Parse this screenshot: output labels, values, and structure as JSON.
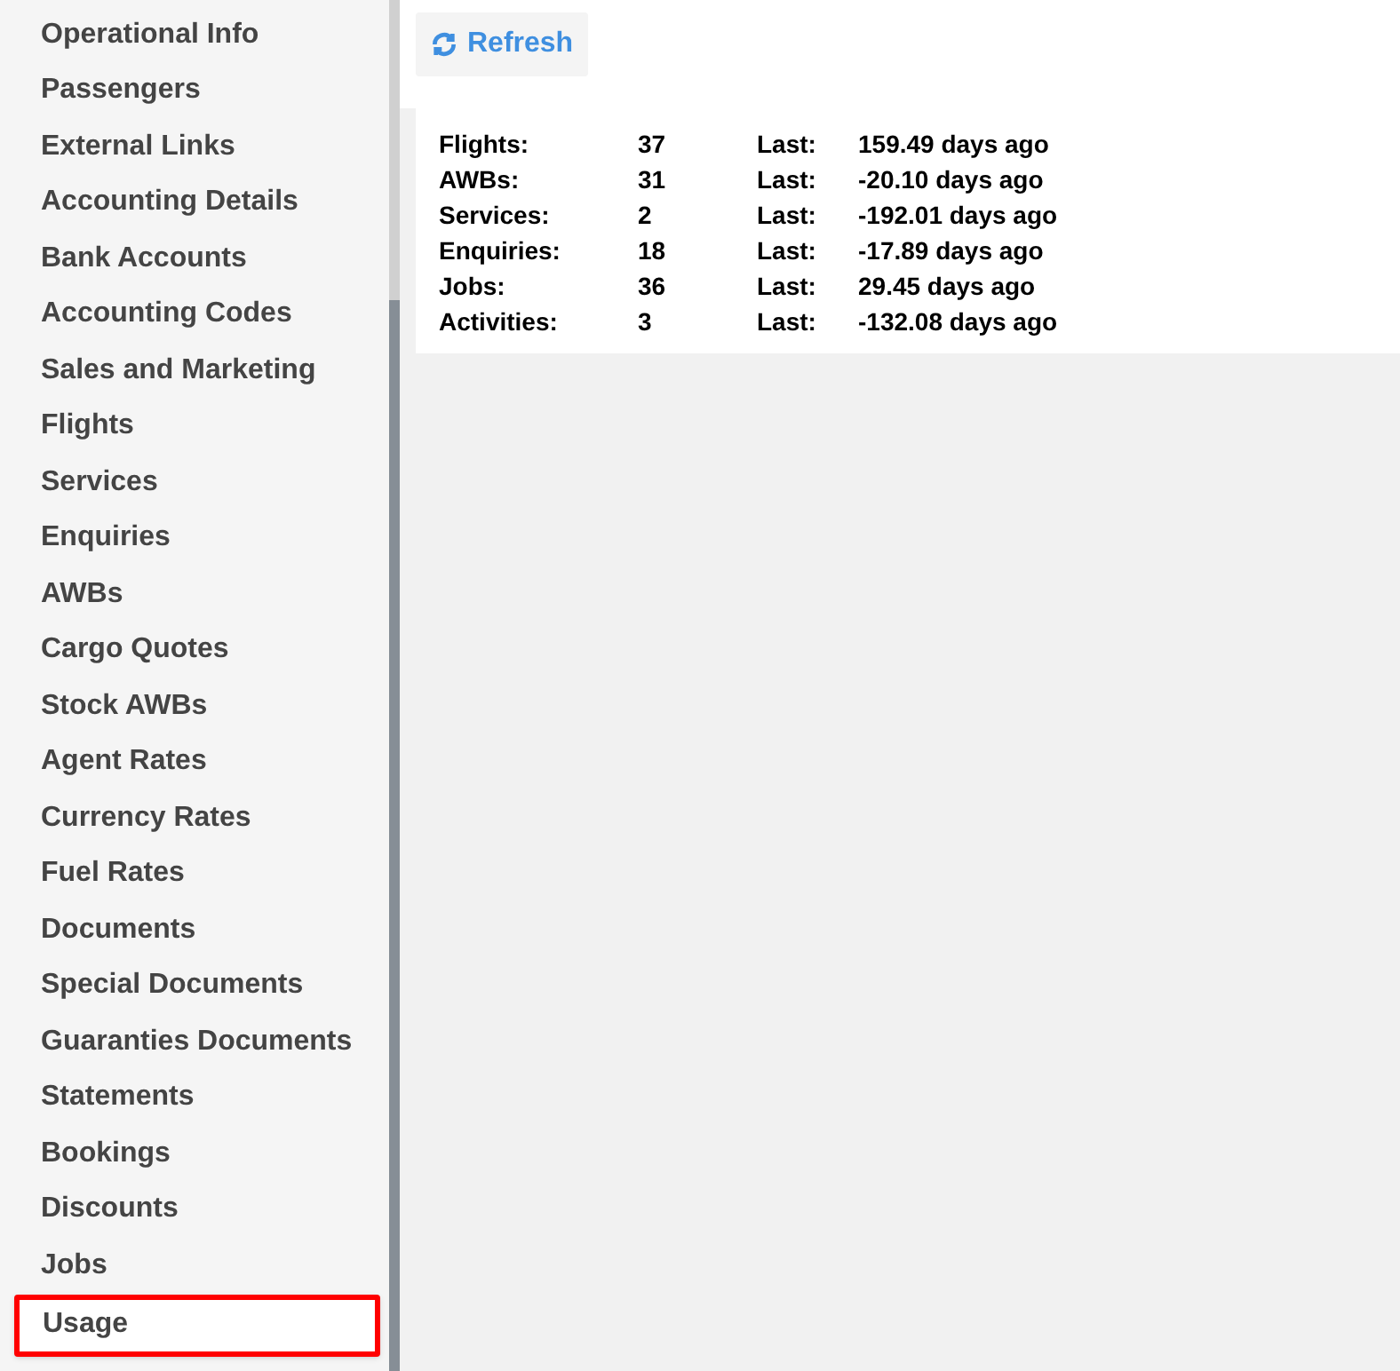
{
  "sidebar": {
    "items": [
      {
        "label": "Operational Info",
        "selected": false
      },
      {
        "label": "Passengers",
        "selected": false
      },
      {
        "label": "External Links",
        "selected": false
      },
      {
        "label": "Accounting Details",
        "selected": false
      },
      {
        "label": "Bank Accounts",
        "selected": false
      },
      {
        "label": "Accounting Codes",
        "selected": false
      },
      {
        "label": "Sales and Marketing",
        "selected": false
      },
      {
        "label": "Flights",
        "selected": false
      },
      {
        "label": "Services",
        "selected": false
      },
      {
        "label": "Enquiries",
        "selected": false
      },
      {
        "label": "AWBs",
        "selected": false
      },
      {
        "label": "Cargo Quotes",
        "selected": false
      },
      {
        "label": "Stock AWBs",
        "selected": false
      },
      {
        "label": "Agent Rates",
        "selected": false
      },
      {
        "label": "Currency Rates",
        "selected": false
      },
      {
        "label": "Fuel Rates",
        "selected": false
      },
      {
        "label": "Documents",
        "selected": false
      },
      {
        "label": "Special Documents",
        "selected": false
      },
      {
        "label": "Guaranties Documents",
        "selected": false
      },
      {
        "label": "Statements",
        "selected": false
      },
      {
        "label": "Bookings",
        "selected": false
      },
      {
        "label": "Discounts",
        "selected": false
      },
      {
        "label": "Jobs",
        "selected": false
      },
      {
        "label": "Usage",
        "selected": true
      }
    ]
  },
  "refresh_button": {
    "label": "Refresh"
  },
  "usage_stats": [
    {
      "name": "Flights:",
      "count": "37",
      "last_label": "Last:",
      "last": "159.49 days ago"
    },
    {
      "name": "AWBs:",
      "count": "31",
      "last_label": "Last:",
      "last": "-20.10 days ago"
    },
    {
      "name": "Services:",
      "count": "2",
      "last_label": "Last:",
      "last": "-192.01 days ago"
    },
    {
      "name": "Enquiries:",
      "count": "18",
      "last_label": "Last:",
      "last": "-17.89 days ago"
    },
    {
      "name": "Jobs:",
      "count": "36",
      "last_label": "Last:",
      "last": "29.45 days ago"
    },
    {
      "name": "Activities:",
      "count": "3",
      "last_label": "Last:",
      "last": "-132.08 days ago"
    }
  ]
}
